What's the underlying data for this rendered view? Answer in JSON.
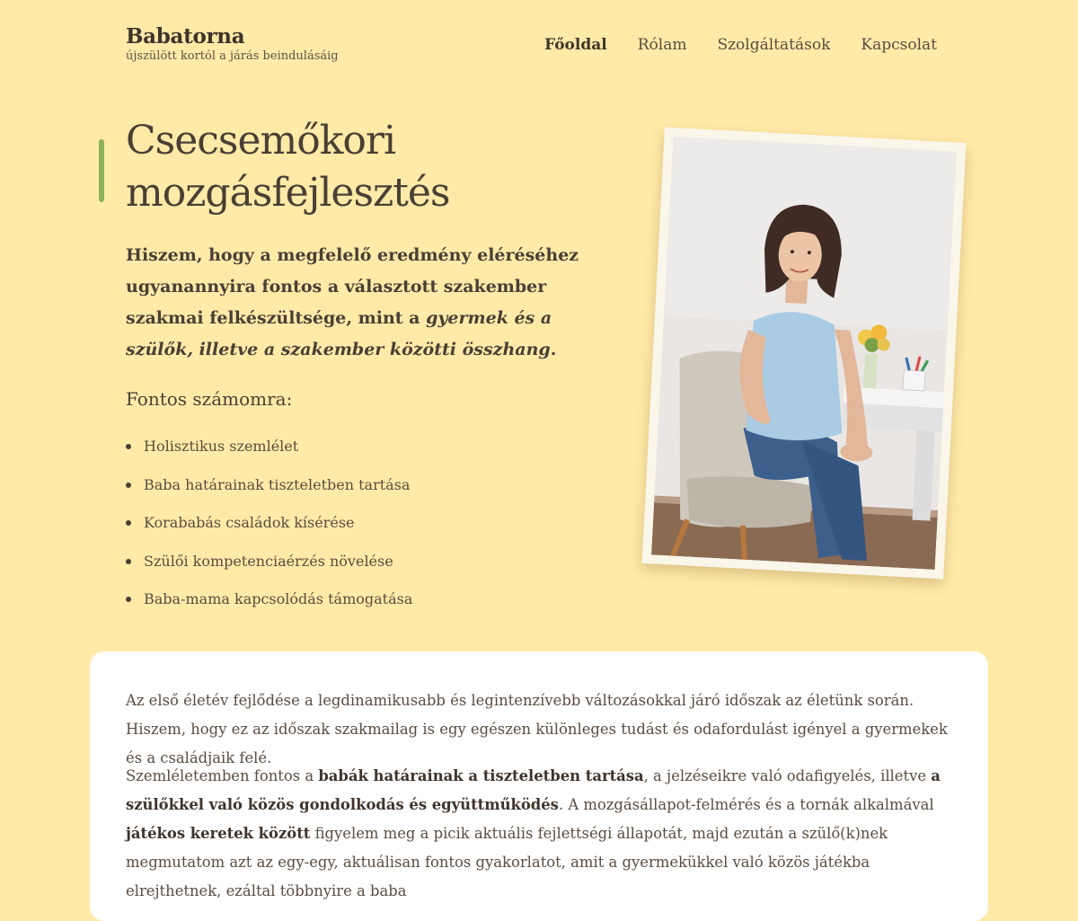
{
  "header": {
    "brand_name": "Babatorna",
    "tagline": "újszülött kortól a járás beindulásáig",
    "nav": [
      {
        "label": "Főoldal",
        "active": true
      },
      {
        "label": "Rólam",
        "active": false
      },
      {
        "label": "Szolgáltatások",
        "active": false
      },
      {
        "label": "Kapcsolat",
        "active": false
      }
    ]
  },
  "hero": {
    "title": "Csecsemőkori mozgásfejlesztés",
    "lead_plain": "Hiszem, hogy a megfelelő eredmény eléréséhez ugyanannyira fontos a választott szakember szakmai felkészültsége, mint a ",
    "lead_italic": "gyermek és a szülők, illetve a szakember közötti összhang",
    "lead_end": ".",
    "values_heading": "Fontos számomra:",
    "values": [
      "Holisztikus szemlélet",
      "Baba határainak tiszteletben tartása",
      "Korababás családok kísérése",
      "Szülői kompetenciaérzés növelése",
      "Baba-mama kapcsolódás támogatása"
    ]
  },
  "content": {
    "p1": "Az első életév fejlődése a legdinamikusabb és legintenzívebb változásokkal járó időszak az életünk során. Hiszem, hogy ez az időszak szakmailag is egy egészen különleges tudást és odafordulást igényel a gyermekek és a családjaik felé.",
    "p2_a": "Szemléletemben fontos a ",
    "p2_b": "babák határainak a tiszteletben tartása",
    "p2_c": ", a jelzéseikre való odafigyelés, illetve ",
    "p2_d": "a szülőkkel való közös gondolkodás és együttműködés",
    "p2_e": ". A mozgásállapot-felmérés és a tornák alkalmával ",
    "p2_f": "játékos keretek között",
    "p2_g": " figyelem meg a picik aktuális fejlettségi állapotát, majd ezután a szülő(k)nek megmutatom azt az egy-egy, aktuálisan fontos gyakorlatot, amit a gyermekükkel való közös játékba elrejthetnek, ezáltal többnyire a baba"
  },
  "colors": {
    "background": "#ffeaa8",
    "accent": "#8bb35d",
    "text": "#4a3f35",
    "card": "#ffffff"
  }
}
